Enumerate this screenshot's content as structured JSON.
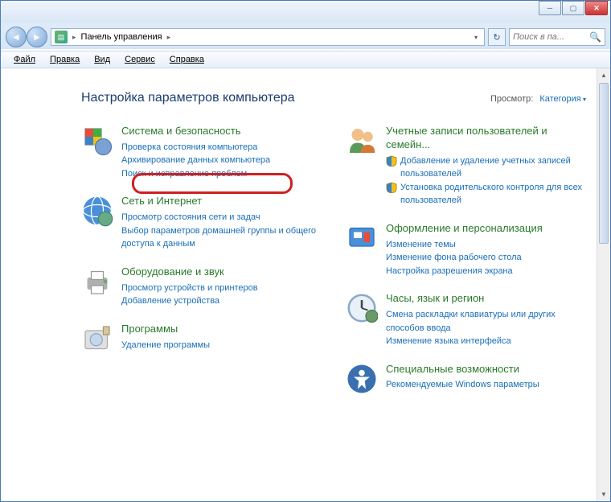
{
  "window": {
    "title": "Панель управления"
  },
  "address": {
    "location": "Панель управления",
    "separator": "▸"
  },
  "search": {
    "placeholder": "Поиск в па..."
  },
  "menu": {
    "file": "Файл",
    "edit": "Правка",
    "view": "Вид",
    "tools": "Сервис",
    "help": "Справка"
  },
  "header": {
    "title": "Настройка параметров компьютера",
    "view_label": "Просмотр:",
    "view_value": "Категория"
  },
  "left_col": [
    {
      "id": "system-security",
      "title": "Система и безопасность",
      "icon": "shield",
      "links": [
        {
          "text": "Проверка состояния компьютера"
        },
        {
          "text": "Архивирование данных компьютера"
        },
        {
          "text": "Поиск и исправление проблем"
        }
      ]
    },
    {
      "id": "network-internet",
      "title": "Сеть и Интернет",
      "icon": "globe",
      "links": [
        {
          "text": "Просмотр состояния сети и задач"
        },
        {
          "text": "Выбор параметров домашней группы и общего доступа к данным"
        }
      ]
    },
    {
      "id": "hardware-sound",
      "title": "Оборудование и звук",
      "icon": "printer",
      "links": [
        {
          "text": "Просмотр устройств и принтеров"
        },
        {
          "text": "Добавление устройства"
        }
      ]
    },
    {
      "id": "programs",
      "title": "Программы",
      "icon": "program",
      "links": [
        {
          "text": "Удаление программы"
        }
      ]
    }
  ],
  "right_col": [
    {
      "id": "user-accounts",
      "title": "Учетные записи пользователей и семейн...",
      "icon": "users",
      "links": [
        {
          "text": "Добавление и удаление учетных записей пользователей",
          "shield": true
        },
        {
          "text": "Установка родительского контроля для всех пользователей",
          "shield": true
        }
      ]
    },
    {
      "id": "appearance",
      "title": "Оформление и персонализация",
      "icon": "appearance",
      "links": [
        {
          "text": "Изменение темы"
        },
        {
          "text": "Изменение фона рабочего стола"
        },
        {
          "text": "Настройка разрешения экрана"
        }
      ]
    },
    {
      "id": "clock-region",
      "title": "Часы, язык и регион",
      "icon": "clock",
      "links": [
        {
          "text": "Смена раскладки клавиатуры или других способов ввода"
        },
        {
          "text": "Изменение языка интерфейса"
        }
      ]
    },
    {
      "id": "ease-of-access",
      "title": "Специальные возможности",
      "icon": "ease",
      "links": [
        {
          "text": "Рекомендуемые Windows параметры"
        }
      ]
    }
  ]
}
